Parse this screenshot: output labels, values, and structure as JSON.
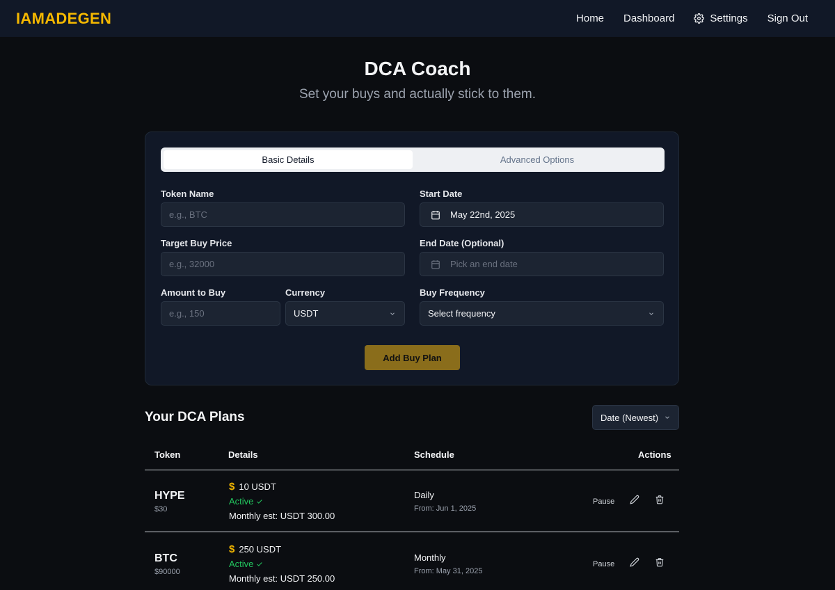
{
  "nav": {
    "brand": "IAMADEGEN",
    "links": {
      "home": "Home",
      "dashboard": "Dashboard",
      "settings": "Settings",
      "signout": "Sign Out"
    }
  },
  "hero": {
    "title": "DCA Coach",
    "subtitle": "Set your buys and actually stick to them."
  },
  "form": {
    "tabs": {
      "basic": "Basic Details",
      "advanced": "Advanced Options"
    },
    "token_name": {
      "label": "Token Name",
      "placeholder": "e.g., BTC"
    },
    "start_date": {
      "label": "Start Date",
      "value": "May 22nd, 2025"
    },
    "target_price": {
      "label": "Target Buy Price",
      "placeholder": "e.g., 32000"
    },
    "end_date": {
      "label": "End Date (Optional)",
      "placeholder": "Pick an end date"
    },
    "amount": {
      "label": "Amount to Buy",
      "placeholder": "e.g., 150"
    },
    "currency": {
      "label": "Currency",
      "value": "USDT"
    },
    "frequency": {
      "label": "Buy Frequency",
      "value": "Select frequency"
    },
    "submit": "Add Buy Plan"
  },
  "plans": {
    "title": "Your DCA Plans",
    "sort": "Date (Newest)",
    "headers": {
      "token": "Token",
      "details": "Details",
      "schedule": "Schedule",
      "actions": "Actions"
    },
    "rows": [
      {
        "token": "HYPE",
        "price": "$30",
        "amount": "10 USDT",
        "status": "Active",
        "monthly": "Monthly est: USDT 300.00",
        "frequency": "Daily",
        "from": "From: Jun 1, 2025",
        "pause": "Pause"
      },
      {
        "token": "BTC",
        "price": "$90000",
        "amount": "250 USDT",
        "status": "Active",
        "monthly": "Monthly est: USDT 250.00",
        "frequency": "Monthly",
        "from": "From: May 31, 2025",
        "pause": "Pause"
      }
    ]
  },
  "colors": {
    "accent": "#f5b800",
    "active": "#22c55e",
    "button": "#8a6d1b"
  }
}
